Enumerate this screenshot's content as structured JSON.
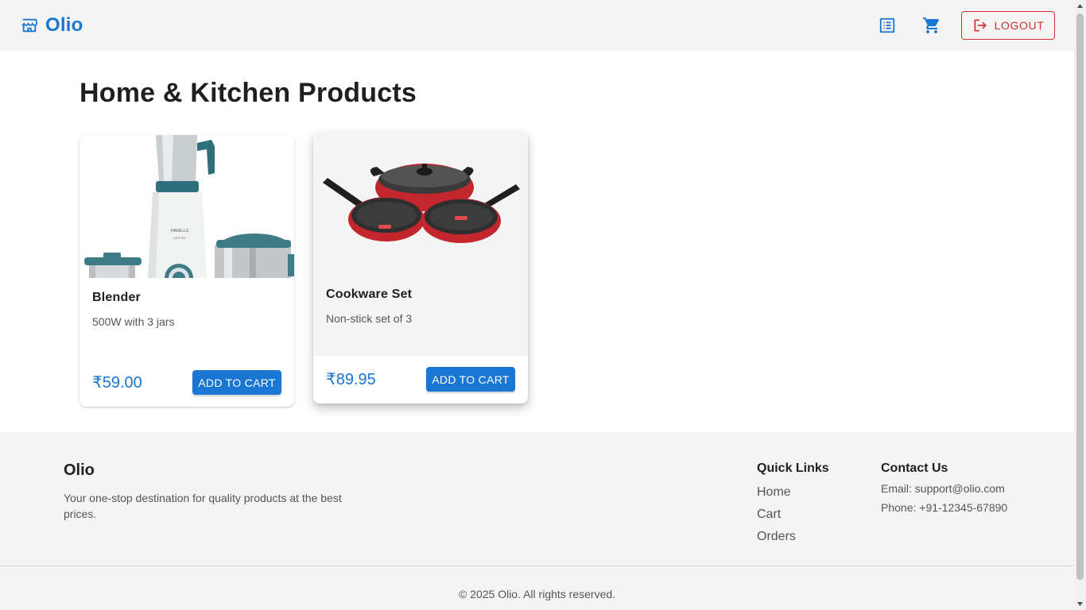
{
  "header": {
    "brand_name": "Olio",
    "logout_label": "LOGOUT",
    "icons": {
      "brand": "storefront-icon",
      "orders": "list-alt-icon",
      "cart": "shopping-cart-icon",
      "logout": "logout-icon"
    }
  },
  "main": {
    "title": "Home & Kitchen Products",
    "products": [
      {
        "name": "Blender",
        "description": "500W with 3 jars",
        "price": "₹59.00",
        "button_label": "ADD TO CART"
      },
      {
        "name": "Cookware Set",
        "description": "Non-stick set of 3",
        "price": "₹89.95",
        "button_label": "ADD TO CART"
      }
    ]
  },
  "footer": {
    "brand_name": "Olio",
    "tagline": "Your one-stop destination for quality products at the best prices.",
    "quick_links": {
      "heading": "Quick Links",
      "items": [
        "Home",
        "Cart",
        "Orders"
      ]
    },
    "contact": {
      "heading": "Contact Us",
      "email": "Email: support@olio.com",
      "phone": "Phone: +91-12345-67890"
    },
    "copyright": "© 2025 Olio. All rights reserved."
  },
  "colors": {
    "primary": "#1976d2",
    "danger": "#d32f2f",
    "header_bg": "#f4f4f4"
  }
}
